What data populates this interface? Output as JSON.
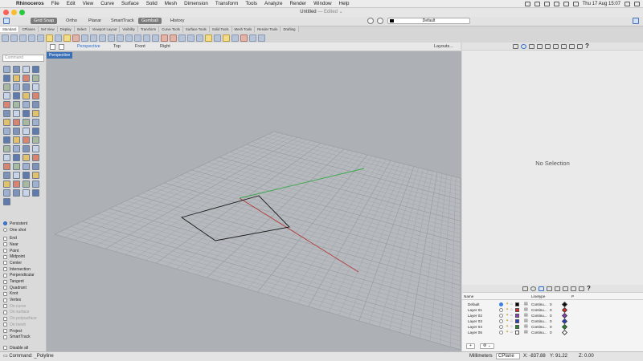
{
  "menubar": {
    "app": "Rhinoceros",
    "items": [
      "File",
      "Edit",
      "View",
      "Curve",
      "Surface",
      "Solid",
      "Mesh",
      "Dimension",
      "Transform",
      "Tools",
      "Analyze",
      "Render",
      "Window",
      "Help"
    ],
    "clock": "Thu 17 Aug  15:07"
  },
  "window": {
    "title": "Untitled",
    "edited": "— Edited ⌄"
  },
  "modes": {
    "items": [
      "Grid Snap",
      "Ortho",
      "Planar",
      "SmartTrack",
      "Gumball",
      "History"
    ],
    "active": [
      "Grid Snap",
      "Gumball"
    ]
  },
  "layer_selector": {
    "value": "Default"
  },
  "tabs": {
    "items": [
      "Standard",
      "CPlanes",
      "Set View",
      "Display",
      "Select",
      "Viewport Layout",
      "Visibility",
      "Transform",
      "Curve Tools",
      "Surface Tools",
      "Solid Tools",
      "Mesh Tools",
      "Render Tools",
      "Drafting"
    ],
    "active": "Standard"
  },
  "command": {
    "placeholder": "Command"
  },
  "osnap": {
    "modes": [
      {
        "label": "Persistent",
        "kind": "radio",
        "on": true
      },
      {
        "label": "One shot",
        "kind": "radio",
        "on": false
      }
    ],
    "items": [
      {
        "label": "End",
        "dim": false
      },
      {
        "label": "Near",
        "dim": false
      },
      {
        "label": "Point",
        "dim": false
      },
      {
        "label": "Midpoint",
        "dim": false
      },
      {
        "label": "Center",
        "dim": false
      },
      {
        "label": "Intersection",
        "dim": false
      },
      {
        "label": "Perpendicular",
        "dim": false
      },
      {
        "label": "Tangent",
        "dim": false
      },
      {
        "label": "Quadrant",
        "dim": false
      },
      {
        "label": "Knot",
        "dim": false
      },
      {
        "label": "Vertex",
        "dim": false
      },
      {
        "label": "On curve",
        "dim": true
      },
      {
        "label": "On surface",
        "dim": true
      },
      {
        "label": "On polysurface",
        "dim": true
      },
      {
        "label": "On mesh",
        "dim": true
      },
      {
        "label": "Project",
        "dim": false
      },
      {
        "label": "SmartTrack",
        "dim": false
      }
    ],
    "disable_all": "Disable all"
  },
  "viewport": {
    "tabs": [
      "Perspective",
      "Top",
      "Front",
      "Right"
    ],
    "active": "Perspective",
    "layouts": "Layouts...",
    "label": "Perspective"
  },
  "properties": {
    "empty": "No Selection"
  },
  "layers": {
    "headers": {
      "name": "Name",
      "linetype": "Linetype",
      "print": "P"
    },
    "rows": [
      {
        "name": "Default",
        "current": true,
        "color": "#000000",
        "line": "Continu...",
        "val": "0",
        "mat": "#000000"
      },
      {
        "name": "Layer 01",
        "current": false,
        "color": "#e02424",
        "line": "Continu...",
        "val": "0",
        "mat": "#e02424"
      },
      {
        "name": "Layer 02",
        "current": false,
        "color": "#8a3cc8",
        "line": "Continu...",
        "val": "0",
        "mat": "#8a3cc8"
      },
      {
        "name": "Layer 03",
        "current": false,
        "color": "#2a3fd0",
        "line": "Continu...",
        "val": "0",
        "mat": "#2a3fd0"
      },
      {
        "name": "Layer 04",
        "current": false,
        "color": "#1f8a2a",
        "line": "Continu...",
        "val": "0",
        "mat": "#1f8a2a"
      },
      {
        "name": "Layer 05",
        "current": false,
        "color": "#ffffff",
        "line": "Continu...",
        "val": "0",
        "mat": "#ffffff"
      }
    ],
    "add": "+",
    "gear": "⚙ ⌄"
  },
  "status": {
    "command": "Command: _Polyline",
    "units": "Millimeters",
    "cplane": "CPlane",
    "x": "X: -837.88",
    "y": "Y: 91.22",
    "z": "Z: 0.00"
  },
  "colors": {
    "viewport_bg": "#adb1b5",
    "grid": "#9a9ea3",
    "x_axis": "#b23a3a",
    "y_axis": "#3aa84a",
    "accent": "#2d6dd0"
  }
}
